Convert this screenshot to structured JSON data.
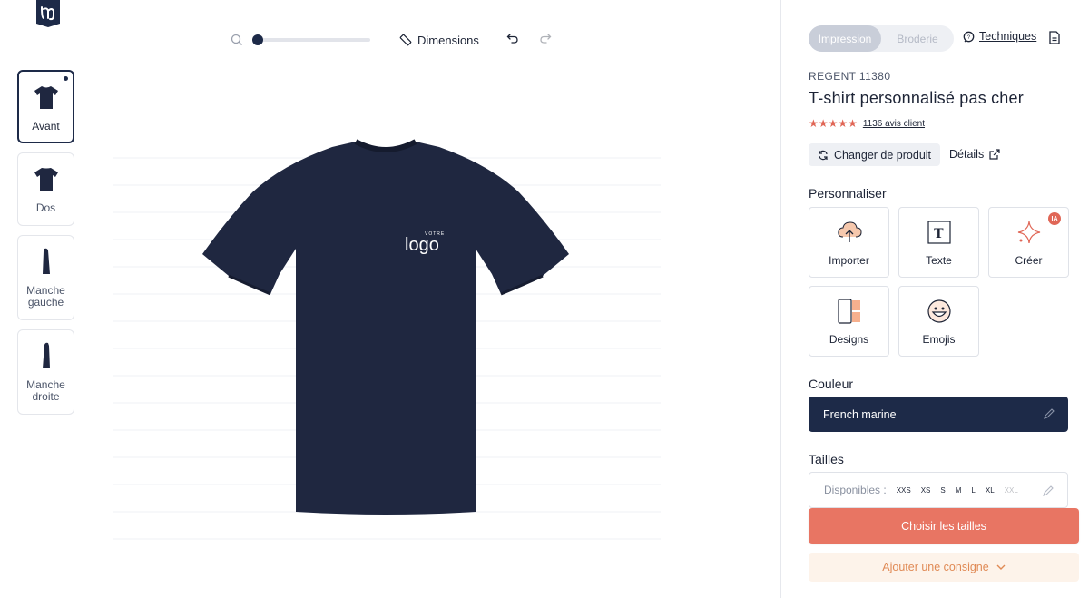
{
  "brand": {
    "logo_icon": "brand-logo-icon"
  },
  "toolbar": {
    "zoom_level": 0.0,
    "dimensions_label": "Dimensions"
  },
  "views": [
    {
      "label": "Avant",
      "active": true
    },
    {
      "label": "Dos",
      "active": false
    },
    {
      "label": "Manche gauche",
      "active": false
    },
    {
      "label": "Manche droite",
      "active": false
    }
  ],
  "mockup": {
    "logo_top": "VOTRE",
    "logo_main": "logo",
    "shirt_color": "#1f2740"
  },
  "panel": {
    "tabs": [
      "Impression",
      "Broderie"
    ],
    "techniques_label": "Techniques",
    "reference": "REGENT 11380",
    "product_title": "T-shirt personnalisé pas cher",
    "rating": 4.5,
    "reviews_label": "1136 avis client",
    "change_product_label": "Changer de produit",
    "details_label": "Détails",
    "personalize_title": "Personnaliser",
    "tools": [
      {
        "label": "Importer",
        "icon": "cloud-upload-icon"
      },
      {
        "label": "Texte",
        "icon": "text-icon"
      },
      {
        "label": "Créer",
        "icon": "sparkle-icon",
        "badge": "IA"
      },
      {
        "label": "Designs",
        "icon": "designs-icon"
      },
      {
        "label": "Emojis",
        "icon": "emoji-icon"
      }
    ],
    "color_title": "Couleur",
    "color_value": "French marine",
    "sizes_title": "Tailles",
    "sizes_available_label": "Disponibles :",
    "sizes": [
      "XXS",
      "XS",
      "S",
      "M",
      "L",
      "XL",
      "XXL"
    ],
    "cta_label": "Choisir les tailles",
    "consigne_label": "Ajouter une consigne"
  },
  "colors": {
    "navy": "#1d2a48",
    "accent": "#e87563",
    "accent_light": "#fdf3ea"
  }
}
